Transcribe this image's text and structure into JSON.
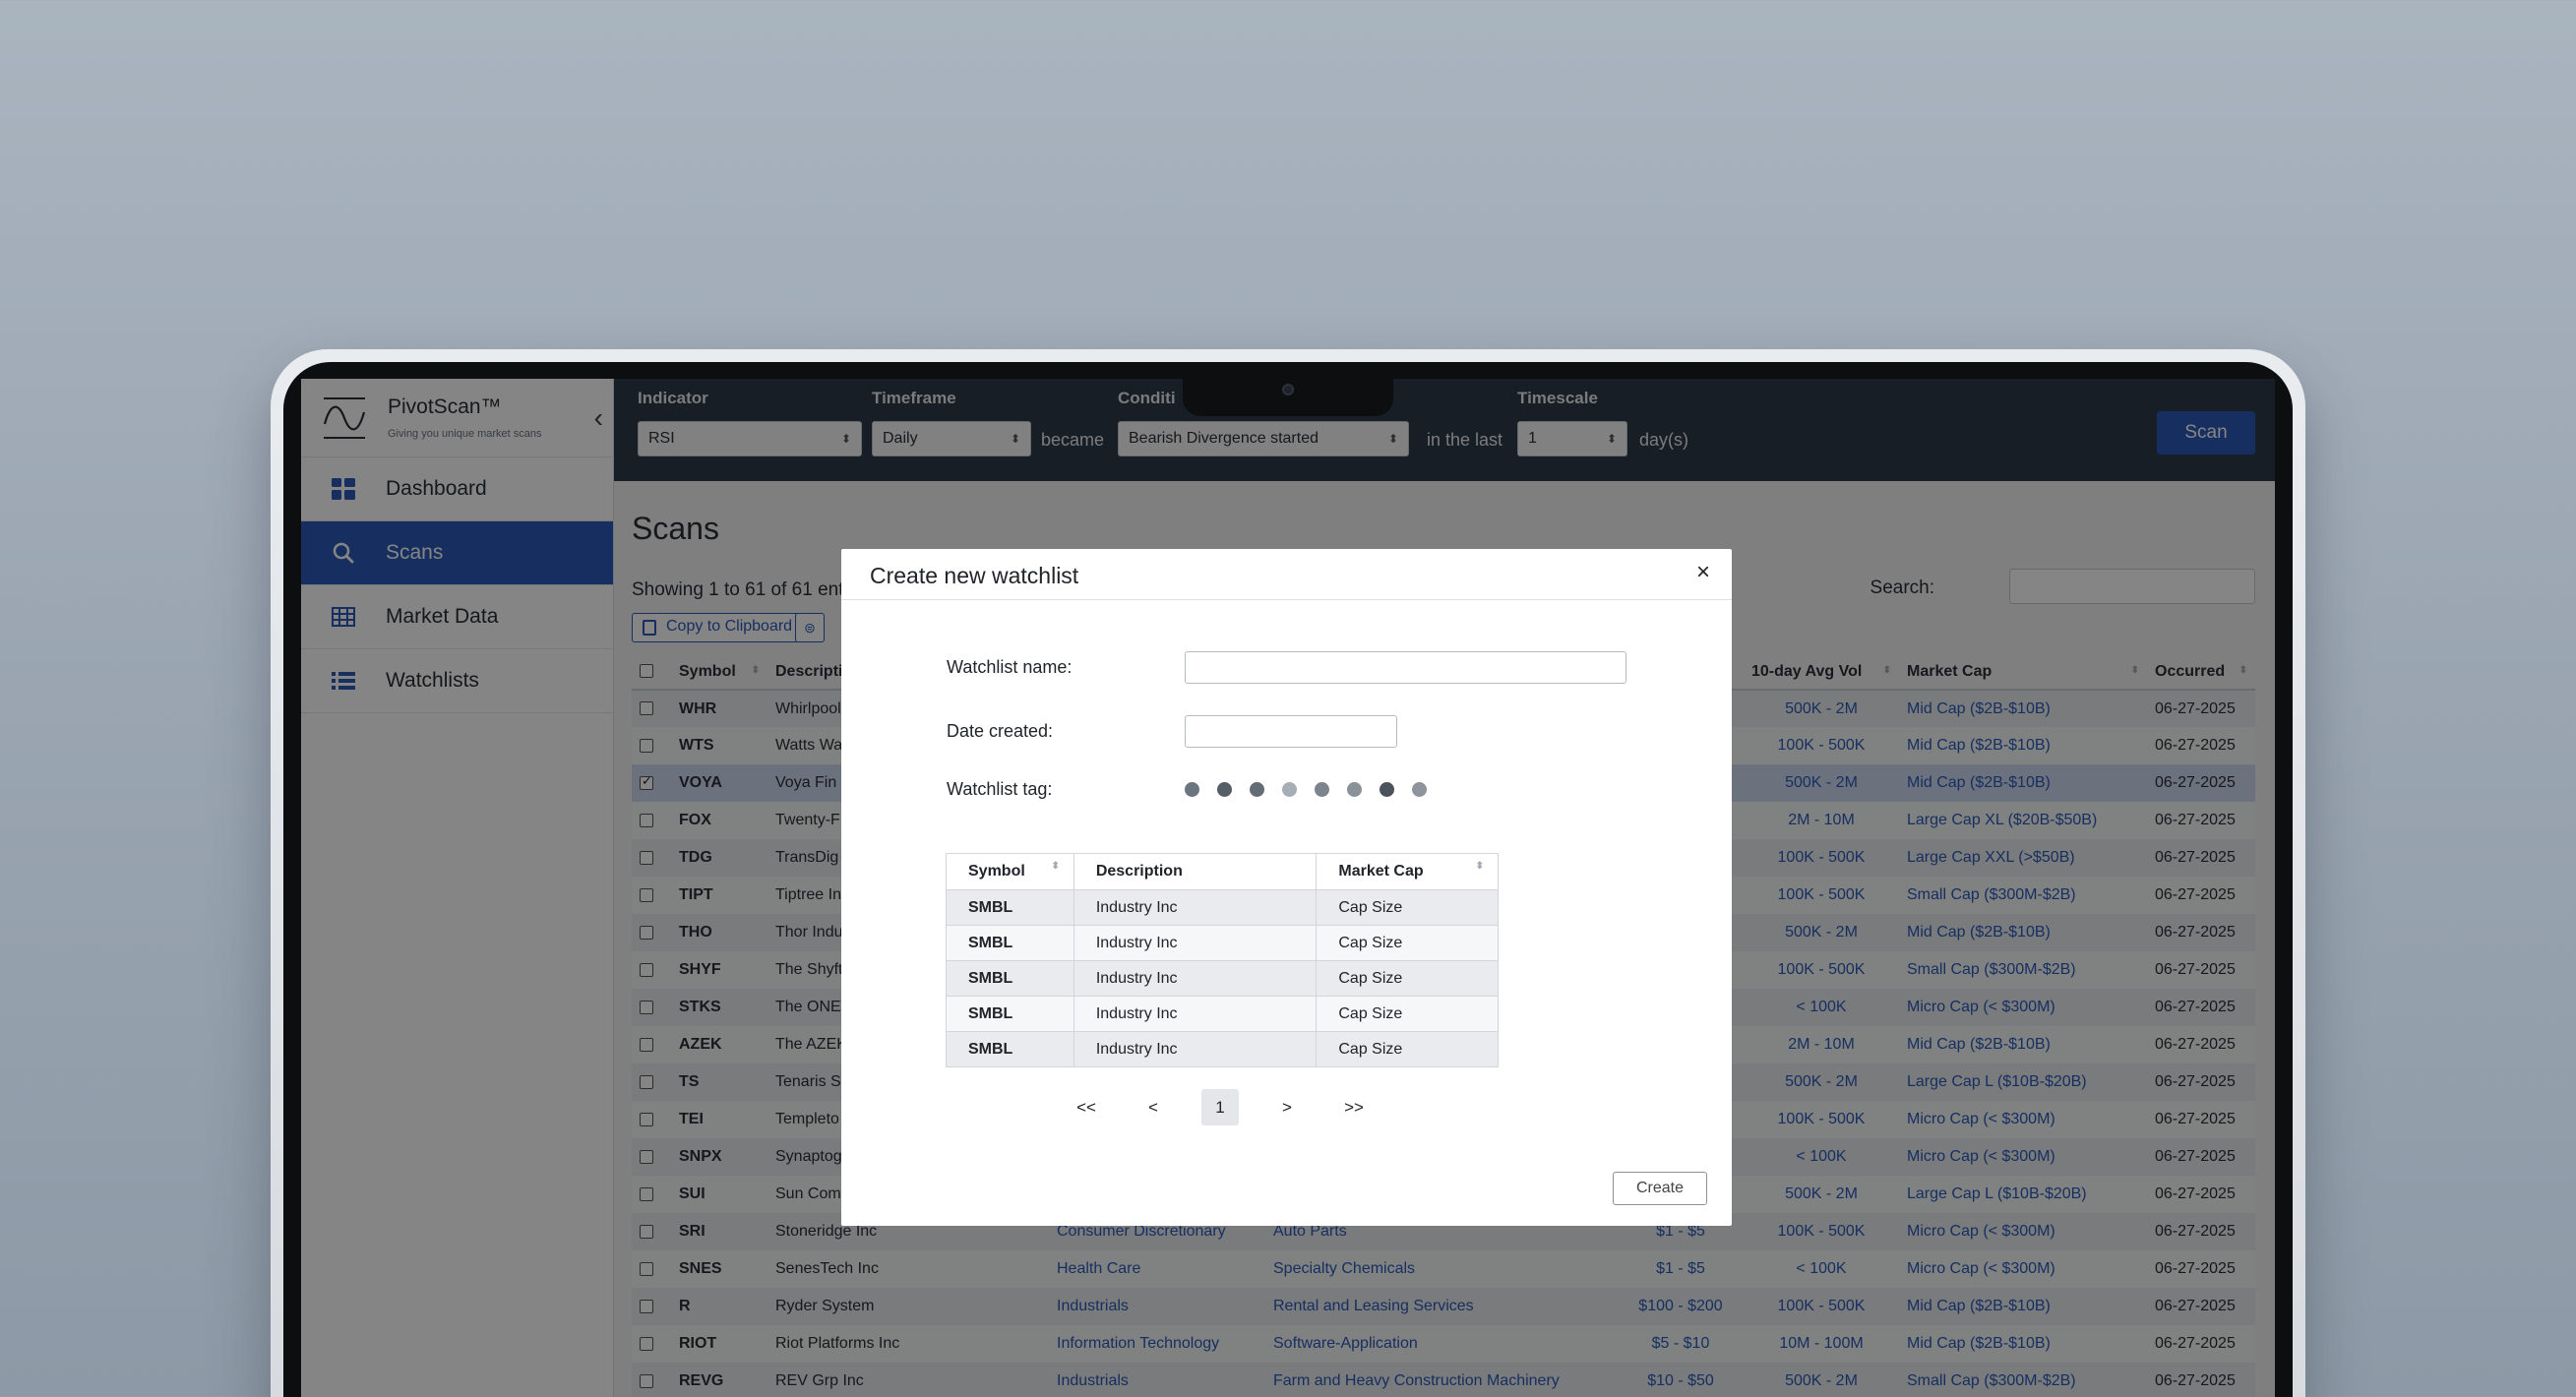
{
  "app": {
    "name": "PivotScan™",
    "tagline": "Giving you unique market scans"
  },
  "sidebar": {
    "items": [
      {
        "label": "Dashboard",
        "icon": "dashboard-icon"
      },
      {
        "label": "Scans",
        "icon": "search-icon",
        "active": true
      },
      {
        "label": "Market Data",
        "icon": "table-icon"
      },
      {
        "label": "Watchlists",
        "icon": "list-icon"
      }
    ]
  },
  "toolbar": {
    "indicator_label": "Indicator",
    "indicator_value": "RSI",
    "timeframe_label": "Timeframe",
    "timeframe_value": "Daily",
    "became_text": "became",
    "condition_label": "Conditi",
    "condition_value": "Bearish Divergence started",
    "in_the_last_text": "in the last",
    "timescale_label": "Timescale",
    "timescale_value": "1",
    "days_text": "day(s)",
    "scan_label": "Scan"
  },
  "page": {
    "title": "Scans",
    "showing": "Showing 1 to 61 of 61 entr",
    "copy_label": "Copy to Clipboard",
    "search_label": "Search:"
  },
  "table": {
    "headers": [
      "Symbol",
      "Descripti",
      "",
      "",
      "",
      "10-day Avg Vol",
      "Market Cap",
      "Occurred"
    ],
    "rows": [
      {
        "symbol": "WHR",
        "desc": "Whirlpool",
        "sector": "",
        "industry": "",
        "price": "",
        "vol": "500K - 2M",
        "cap": "Mid Cap ($2B-$10B)",
        "date": "06-27-2025"
      },
      {
        "symbol": "WTS",
        "desc": "Watts Wa",
        "sector": "",
        "industry": "",
        "price": "",
        "vol": "100K - 500K",
        "cap": "Mid Cap ($2B-$10B)",
        "date": "06-27-2025"
      },
      {
        "symbol": "VOYA",
        "desc": "Voya Fin",
        "sector": "",
        "industry": "",
        "price": "",
        "vol": "500K - 2M",
        "cap": "Mid Cap ($2B-$10B)",
        "date": "06-27-2025",
        "checked": true
      },
      {
        "symbol": "FOX",
        "desc": "Twenty-F",
        "sector": "",
        "industry": "",
        "price": "",
        "vol": "2M - 10M",
        "cap": "Large Cap XL ($20B-$50B)",
        "date": "06-27-2025"
      },
      {
        "symbol": "TDG",
        "desc": "TransDig",
        "sector": "",
        "industry": "",
        "price": "",
        "vol": "100K - 500K",
        "cap": "Large Cap XXL (>$50B)",
        "date": "06-27-2025"
      },
      {
        "symbol": "TIPT",
        "desc": "Tiptree In",
        "sector": "",
        "industry": "",
        "price": "",
        "vol": "100K - 500K",
        "cap": "Small Cap ($300M-$2B)",
        "date": "06-27-2025"
      },
      {
        "symbol": "THO",
        "desc": "Thor Indu",
        "sector": "",
        "industry": "",
        "price": "",
        "vol": "500K - 2M",
        "cap": "Mid Cap ($2B-$10B)",
        "date": "06-27-2025"
      },
      {
        "symbol": "SHYF",
        "desc": "The Shyft",
        "sector": "",
        "industry": "",
        "price": "",
        "vol": "100K - 500K",
        "cap": "Small Cap ($300M-$2B)",
        "date": "06-27-2025"
      },
      {
        "symbol": "STKS",
        "desc": "The ONE",
        "sector": "",
        "industry": "",
        "price": "",
        "vol": "< 100K",
        "cap": "Micro Cap (< $300M)",
        "date": "06-27-2025"
      },
      {
        "symbol": "AZEK",
        "desc": "The AZEK",
        "sector": "",
        "industry": "",
        "price": "",
        "vol": "2M - 10M",
        "cap": "Mid Cap ($2B-$10B)",
        "date": "06-27-2025"
      },
      {
        "symbol": "TS",
        "desc": "Tenaris S",
        "sector": "",
        "industry": "",
        "price": "",
        "vol": "500K - 2M",
        "cap": "Large Cap L ($10B-$20B)",
        "date": "06-27-2025"
      },
      {
        "symbol": "TEI",
        "desc": "Templeto",
        "sector": "",
        "industry": "",
        "price": "",
        "vol": "100K - 500K",
        "cap": "Micro Cap (< $300M)",
        "date": "06-27-2025"
      },
      {
        "symbol": "SNPX",
        "desc": "Synaptog",
        "sector": "",
        "industry": "",
        "price": "",
        "vol": "< 100K",
        "cap": "Micro Cap (< $300M)",
        "date": "06-27-2025"
      },
      {
        "symbol": "SUI",
        "desc": "Sun Com",
        "sector": "",
        "industry": "",
        "price": "",
        "vol": "500K - 2M",
        "cap": "Large Cap L ($10B-$20B)",
        "date": "06-27-2025"
      },
      {
        "symbol": "SRI",
        "desc": "Stoneridge Inc",
        "sector": "Consumer Discretionary",
        "industry": "Auto Parts",
        "price": "$1 - $5",
        "vol": "100K - 500K",
        "cap": "Micro Cap (< $300M)",
        "date": "06-27-2025"
      },
      {
        "symbol": "SNES",
        "desc": "SenesTech Inc",
        "sector": "Health Care",
        "industry": "Specialty Chemicals",
        "price": "$1 - $5",
        "vol": "< 100K",
        "cap": "Micro Cap (< $300M)",
        "date": "06-27-2025"
      },
      {
        "symbol": "R",
        "desc": "Ryder System",
        "sector": "Industrials",
        "industry": "Rental and Leasing Services",
        "price": "$100 - $200",
        "vol": "100K - 500K",
        "cap": "Mid Cap ($2B-$10B)",
        "date": "06-27-2025"
      },
      {
        "symbol": "RIOT",
        "desc": "Riot Platforms Inc",
        "sector": "Information Technology",
        "industry": "Software-Application",
        "price": "$5 - $10",
        "vol": "10M - 100M",
        "cap": "Mid Cap ($2B-$10B)",
        "date": "06-27-2025"
      },
      {
        "symbol": "REVG",
        "desc": "REV Grp Inc",
        "sector": "Industrials",
        "industry": "Farm and Heavy Construction Machinery",
        "price": "$10 - $50",
        "vol": "500K - 2M",
        "cap": "Small Cap ($300M-$2B)",
        "date": "06-27-2025"
      }
    ]
  },
  "modal": {
    "title": "Create new watchlist",
    "close": "×",
    "name_label": "Watchlist name:",
    "date_label": "Date created:",
    "tag_label": "Watchlist tag:",
    "tag_colors": [
      "#6b7580",
      "#555d66",
      "#636b74",
      "#a6adb5",
      "#7b838c",
      "#8a9199",
      "#4a525b",
      "#8d949c"
    ],
    "table_headers": [
      "Symbol",
      "Description",
      "Market Cap"
    ],
    "table_rows": [
      [
        "SMBL",
        "Industry Inc",
        "Cap Size"
      ],
      [
        "SMBL",
        "Industry Inc",
        "Cap Size"
      ],
      [
        "SMBL",
        "Industry Inc",
        "Cap Size"
      ],
      [
        "SMBL",
        "Industry Inc",
        "Cap Size"
      ],
      [
        "SMBL",
        "Industry Inc",
        "Cap Size"
      ]
    ],
    "pager": [
      "<<",
      "<",
      "1",
      ">",
      ">>"
    ],
    "create_label": "Create"
  },
  "colors": {
    "accent": "#2d5ab8",
    "topbar": "#2f3a47",
    "link": "#2d5ab8"
  }
}
